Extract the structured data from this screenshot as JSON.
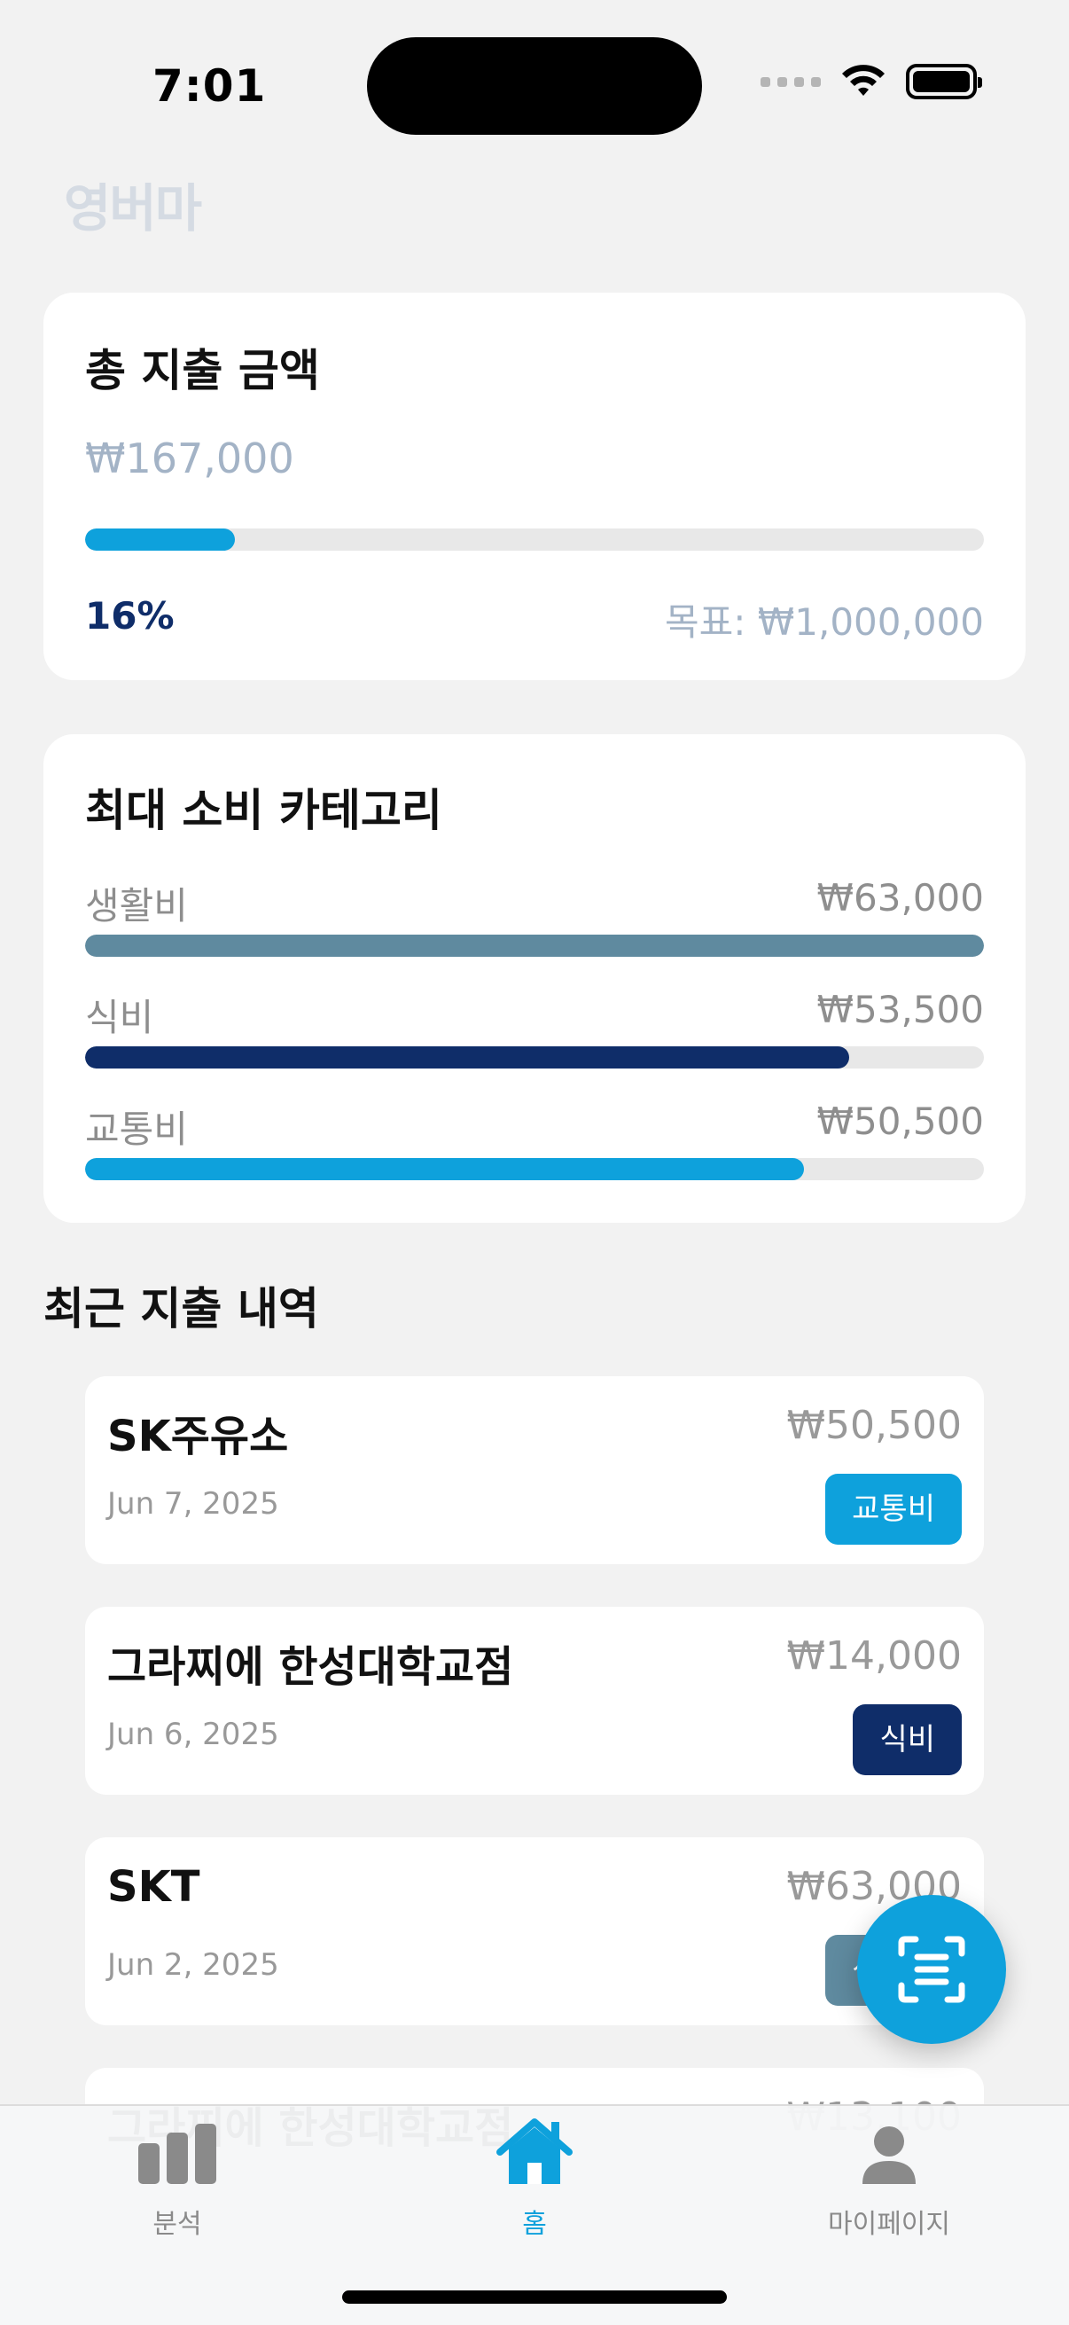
{
  "status": {
    "time": "7:01"
  },
  "app": {
    "logo": "영버마"
  },
  "total": {
    "title": "총 지출 금액",
    "amount": "₩167,000",
    "progress": 0.167,
    "percent": "16%",
    "goal": "목표: ₩1,000,000",
    "bar_color": "#0ea1dc"
  },
  "categories": {
    "title": "최대 소비 카테고리",
    "items": [
      {
        "label": "생활비",
        "amount": "₩63,000",
        "fill": 1.0,
        "color": "#5f8a9f"
      },
      {
        "label": "식비",
        "amount": "₩53,500",
        "fill": 0.85,
        "color": "#0f2d69"
      },
      {
        "label": "교통비",
        "amount": "₩50,500",
        "fill": 0.8,
        "color": "#0ea1dc"
      }
    ]
  },
  "recent": {
    "title": "최근 지출 내역",
    "items": [
      {
        "name": "SK주유소",
        "amount": "₩50,500",
        "date": "Jun 7, 2025",
        "tag": "교통비",
        "tag_color": "#0ea1dc"
      },
      {
        "name": "그라찌에 한성대학교점",
        "amount": "₩14,000",
        "date": "Jun 6, 2025",
        "tag": "식비",
        "tag_color": "#0f2d69"
      },
      {
        "name": "SKT",
        "amount": "₩63,000",
        "date": "Jun 2, 2025",
        "tag": "생활비",
        "tag_color": "#5f8a9f"
      },
      {
        "name": "그라찌에 한성대학교점",
        "amount": "₩13,100",
        "date": "",
        "tag": "",
        "tag_color": "#0f2d69"
      }
    ]
  },
  "fab": {
    "icon": "scan-icon"
  },
  "tabs": [
    {
      "label": "분석",
      "icon": "chart-icon"
    },
    {
      "label": "홈",
      "icon": "home-icon",
      "active": true
    },
    {
      "label": "마이페이지",
      "icon": "person-icon"
    }
  ]
}
